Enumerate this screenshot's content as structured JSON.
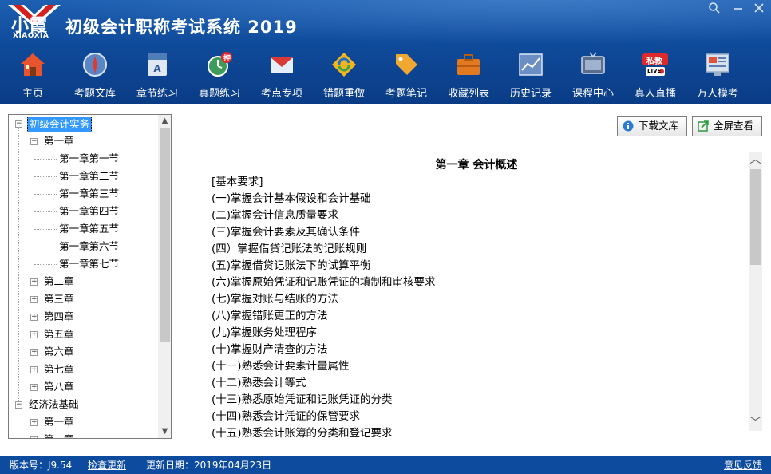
{
  "app": {
    "logo_cn": "小霞",
    "logo_en": "XIAOXIA",
    "title": "初级会计职称考试系统 2019"
  },
  "toolbar": [
    {
      "label": "主页",
      "icon": "home-icon"
    },
    {
      "label": "考题文库",
      "icon": "compass-icon"
    },
    {
      "label": "章节练习",
      "icon": "book-icon"
    },
    {
      "label": "真题练习",
      "icon": "clock-badge-icon"
    },
    {
      "label": "考点专项",
      "icon": "mail-icon"
    },
    {
      "label": "错题重做",
      "icon": "refresh-icon"
    },
    {
      "label": "考题笔记",
      "icon": "tag-icon"
    },
    {
      "label": "收藏列表",
      "icon": "briefcase-icon"
    },
    {
      "label": "历史记录",
      "icon": "chart-icon"
    },
    {
      "label": "课程中心",
      "icon": "tv-icon"
    },
    {
      "label": "真人直播",
      "icon": "live-icon"
    },
    {
      "label": "万人模考",
      "icon": "monitor-icon"
    }
  ],
  "toolbar_badges": {
    "exam": "押",
    "live_top": "私教",
    "live_bottom": "LIVE"
  },
  "tree": {
    "root1": "初级会计实务",
    "chapter1": "第一章",
    "sections": [
      "第一章第一节",
      "第一章第二节",
      "第一章第三节",
      "第一章第四节",
      "第一章第五节",
      "第一章第六节",
      "第一章第七节"
    ],
    "chapters": [
      "第二章",
      "第三章",
      "第四章",
      "第五章",
      "第六章",
      "第七章",
      "第八章"
    ],
    "root2": "经济法基础",
    "root2_children": [
      "第一章",
      "第二章"
    ]
  },
  "buttons": {
    "download": "下载文库",
    "fullscreen": "全屏查看"
  },
  "document": {
    "title": "第一章  会计概述",
    "lines": [
      "[基本要求]",
      "(一)掌握会计基本假设和会计基础",
      "(二)掌握会计信息质量要求",
      "(三)掌握会计要素及其确认条件",
      "(四）掌握借贷记账法的记账规则",
      "(五)掌握借贷记账法下的试算平衡",
      "(六)掌握原始凭证和记账凭证的填制和审核要求",
      "(七)掌握对账与结账的方法",
      "(八)掌握错账更正的方法",
      "(九)掌握账务处理程序",
      "(十)掌握财产清查的方法",
      "(十一)熟悉会计要素计量属性",
      "(十二)熟悉会计等式",
      "(十三)熟悉原始凭证和记账凭证的分类",
      "(十四)熟悉会计凭证的保管要求",
      "(十五)熟悉会计账簿的分类和登记要求"
    ]
  },
  "status": {
    "version_label": "版本号：J9.54",
    "check_update": "检查更新",
    "update_date": "更新日期：2019年04月23日",
    "feedback": "意见反馈"
  },
  "colors": {
    "header": "#0f4a9a",
    "statusbar": "#0d4b9e",
    "selection": "#3399ff"
  }
}
